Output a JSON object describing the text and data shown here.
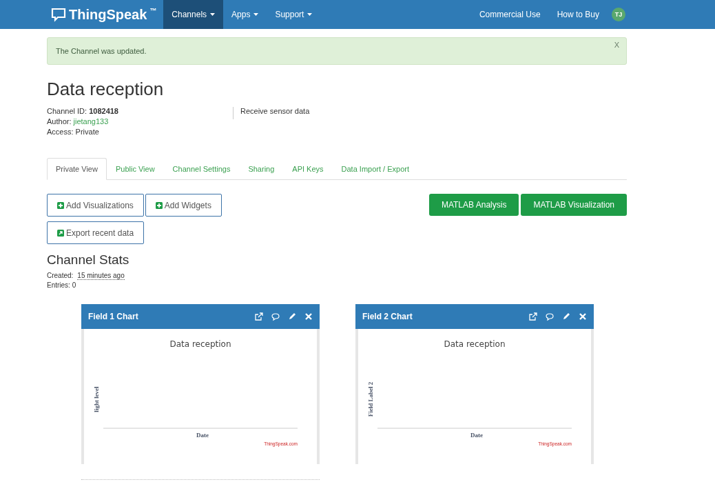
{
  "navbar": {
    "brand": "ThingSpeak",
    "trademark": "™",
    "menus": [
      {
        "label": "Channels",
        "selected": true
      },
      {
        "label": "Apps",
        "selected": false
      },
      {
        "label": "Support",
        "selected": false
      }
    ],
    "links": [
      "Commercial Use",
      "How to Buy"
    ],
    "avatar": "TJ"
  },
  "alert": {
    "message": "The Channel was updated.",
    "close": "X"
  },
  "channel": {
    "title": "Data reception",
    "id_label": "Channel ID:",
    "id": "1082418",
    "author_label": "Author:",
    "author": "jietang133",
    "access": "Access: Private",
    "description": "Receive sensor data"
  },
  "tabs": [
    {
      "label": "Private View",
      "selected": true
    },
    {
      "label": "Public View",
      "selected": false
    },
    {
      "label": "Channel Settings",
      "selected": false
    },
    {
      "label": "Sharing",
      "selected": false
    },
    {
      "label": "API Keys",
      "selected": false
    },
    {
      "label": "Data Import / Export",
      "selected": false
    }
  ],
  "actions": [
    {
      "label": "Add Visualizations",
      "kind": "add"
    },
    {
      "label": "Add Widgets",
      "kind": "add"
    },
    {
      "label": "Export recent data",
      "kind": "export"
    }
  ],
  "matlab_buttons": [
    "MATLAB Analysis",
    "MATLAB Visualization"
  ],
  "stats": {
    "title": "Channel Stats",
    "created_label": "Created:",
    "created": "15 minutes ago",
    "entries": "Entries: 0"
  },
  "charts": [
    {
      "header": "Field 1 Chart",
      "title": "Data reception",
      "ylabel": "light level",
      "xlabel": "Date",
      "credit": "ThingSpeak.com"
    },
    {
      "header": "Field 2 Chart",
      "title": "Data reception",
      "ylabel": "Field Label 2",
      "xlabel": "Date",
      "credit": "ThingSpeak.com"
    }
  ]
}
